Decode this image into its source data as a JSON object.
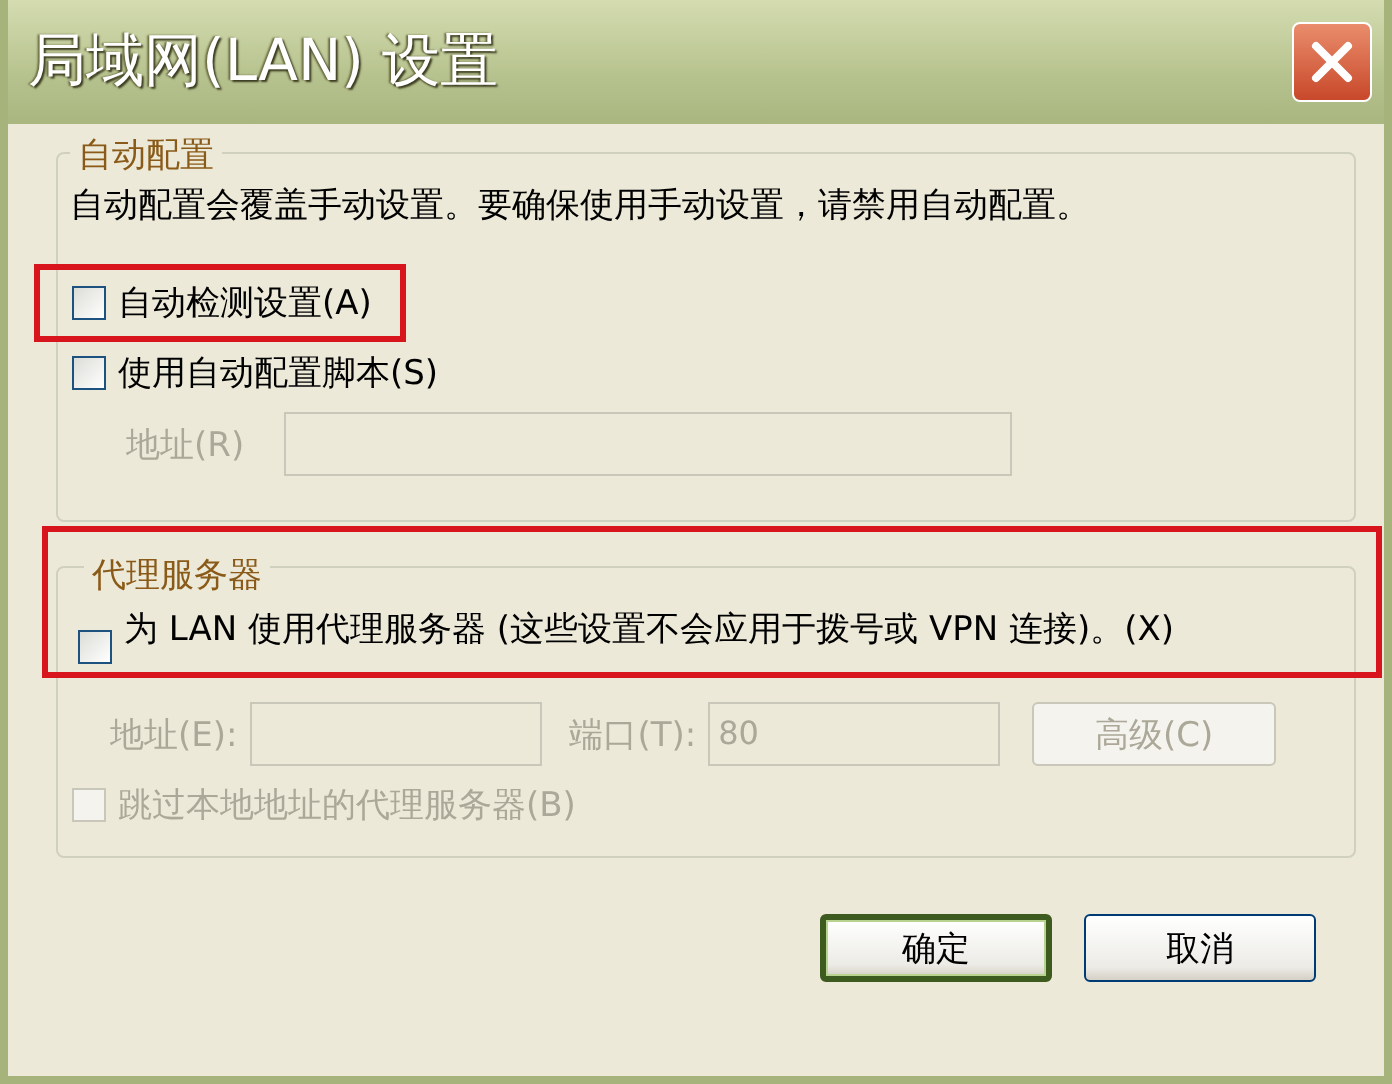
{
  "window": {
    "title": "局域网(LAN) 设置"
  },
  "auto_config": {
    "legend": "自动配置",
    "description": "自动配置会覆盖手动设置。要确保使用手动设置，请禁用自动配置。",
    "checkboxes": [
      {
        "label": "自动检测设置(A)",
        "checked": false,
        "highlighted": true
      },
      {
        "label": "使用自动配置脚本(S)",
        "checked": false,
        "highlighted": false
      }
    ],
    "address": {
      "label": "地址(R)",
      "disabled": true
    }
  },
  "proxy": {
    "legend": "代理服务器",
    "highlighted": true,
    "checkbox": {
      "label": "为 LAN 使用代理服务器 (这些设置不会应用于拨号或 VPN 连接)。(X)",
      "checked": false
    },
    "address": {
      "label": "地址(E):",
      "disabled": true
    },
    "port": {
      "label": "端口(T):",
      "value": "80",
      "disabled": true
    },
    "advanced_button": {
      "label": "高级(C)",
      "disabled": true
    },
    "bypass": {
      "label": "跳过本地地址的代理服务器(B)",
      "checked": false,
      "disabled": true
    }
  },
  "buttons": [
    {
      "label": "确定",
      "default": true
    },
    {
      "label": "取消",
      "default": false
    }
  ]
}
